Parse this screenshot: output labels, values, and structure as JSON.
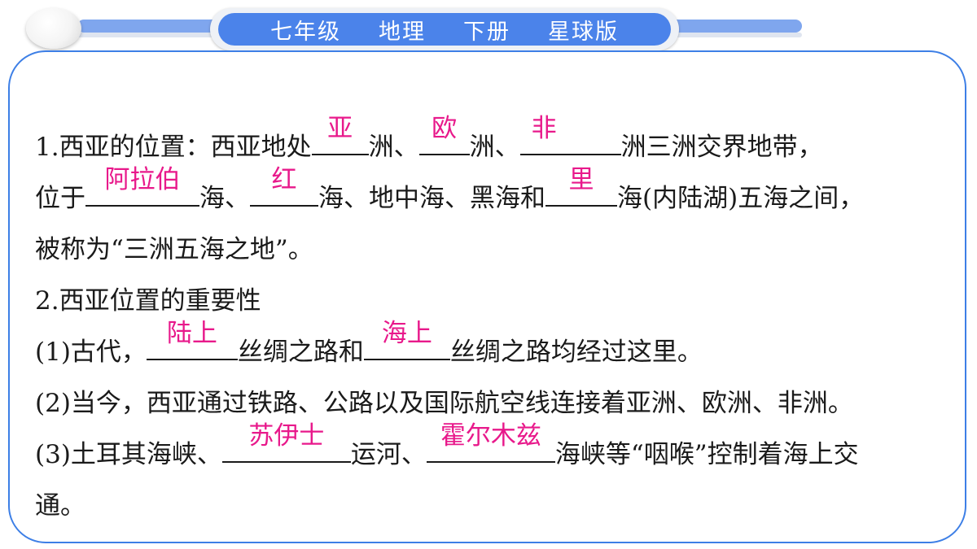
{
  "header": {
    "tags": [
      "七年级",
      "地理",
      "下册",
      "星球版"
    ]
  },
  "lines": {
    "l1": {
      "prefix": "1.西亚的位置：西亚地处",
      "ans1": "亚",
      "t1": "洲、",
      "ans2": "欧",
      "t2": "洲、",
      "ans3": "非",
      "t3": "洲三洲交界地带，"
    },
    "l2": {
      "prefix": "位于",
      "ans1": "阿拉伯",
      "t1": "海、",
      "ans2": "红",
      "t2": "海、地中海、黑海和",
      "ans3": "里",
      "t3": "海(内陆湖)五海之间，"
    },
    "l3": {
      "text": "被称为“三洲五海之地”。"
    },
    "l4": {
      "text": "2.西亚位置的重要性"
    },
    "l5": {
      "prefix": "(1)古代，",
      "ans1": "陆上",
      "t1": "丝绸之路和",
      "ans2": "海上",
      "t2": "丝绸之路均经过这里。"
    },
    "l6": {
      "text": "(2)当今，西亚通过铁路、公路以及国际航空线连接着亚洲、欧洲、非洲。"
    },
    "l7": {
      "prefix": "(3)土耳其海峡、",
      "ans1": "苏伊士",
      "t1": "运河、",
      "ans2": "霍尔木兹",
      "t2": "海峡等“咽喉”控制着海上交"
    },
    "l8": {
      "text": "通。"
    }
  },
  "colors": {
    "answer": "#e8198b",
    "accent": "#4b83ea",
    "border": "#3d7fe6"
  }
}
